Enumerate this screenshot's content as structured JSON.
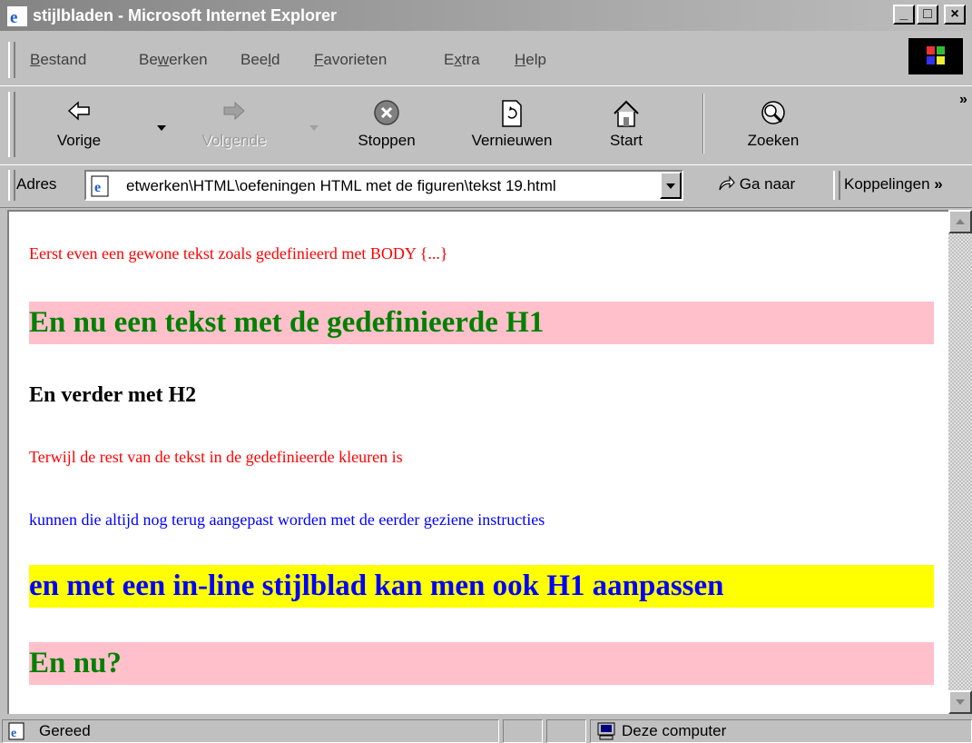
{
  "window": {
    "title": "stijlbladen - Microsoft Internet Explorer",
    "minimize": "_",
    "maximize": "□",
    "close": "×"
  },
  "menu": {
    "items": [
      {
        "pre": "",
        "u": "B",
        "post": "estand"
      },
      {
        "pre": "Be",
        "u": "w",
        "post": "erken"
      },
      {
        "pre": "Bee",
        "u": "l",
        "post": "d"
      },
      {
        "pre": "",
        "u": "F",
        "post": "avorieten"
      },
      {
        "pre": "E",
        "u": "x",
        "post": "tra"
      },
      {
        "pre": "",
        "u": "H",
        "post": "elp"
      }
    ]
  },
  "toolbar": {
    "back": "Vorige",
    "forward": "Volgende",
    "stop": "Stoppen",
    "refresh": "Vernieuwen",
    "home": "Start",
    "search": "Zoeken",
    "more": "»"
  },
  "address": {
    "label": "Adres",
    "url": "etwerken\\HTML\\oefeningen HTML met de figuren\\tekst 19.html",
    "go": "Ga naar",
    "links": "Koppelingen",
    "links_more": "»"
  },
  "content": {
    "p1": "Eerst even een gewone tekst zoals gedefinieerd met BODY {...}",
    "h1": "En nu een tekst met de gedefinieerde H1",
    "h2": "En verder met H2",
    "p2": "Terwijl de rest van de tekst in de gedefinieerde kleuren is",
    "p3": "kunnen die altijd nog terug aangepast worden met de eerder geziene instructies",
    "h1_inline": "en met een in-line stijlblad kan men ook H1 aanpassen",
    "h1_last": "En nu?"
  },
  "colors": {
    "body_text": "#ff0000",
    "h1_text": "#008000",
    "h1_bg": "#ffc0cb",
    "inline_text": "#0000ff",
    "inline_bg": "#ffff00"
  },
  "status": {
    "text": "Gereed",
    "zone": "Deze computer"
  }
}
